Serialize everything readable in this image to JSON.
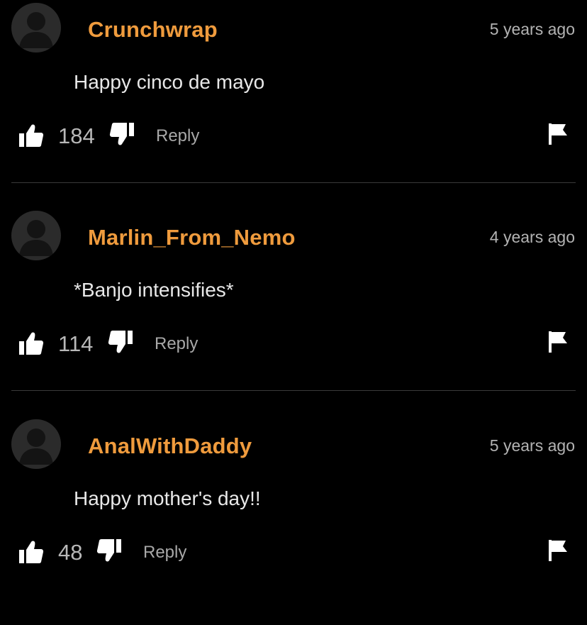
{
  "comments": [
    {
      "username": "Crunchwrap",
      "time": "5 years ago",
      "text": "Happy cinco de mayo",
      "likes": "184",
      "reply_label": "Reply"
    },
    {
      "username": "Marlin_From_Nemo",
      "time": "4 years ago",
      "text": "*Banjo intensifies*",
      "likes": "114",
      "reply_label": "Reply"
    },
    {
      "username": "AnalWithDaddy",
      "time": "5 years ago",
      "text": "Happy mother's day!!",
      "likes": "48",
      "reply_label": "Reply"
    }
  ],
  "icons": {
    "avatar": "default-user-avatar-icon",
    "like": "thumbs-up-icon",
    "dislike": "thumbs-down-icon",
    "flag": "flag-icon"
  },
  "colors": {
    "background": "#000000",
    "username": "#ef9b3d",
    "text": "#e8e8e8",
    "muted": "#b3b3b3",
    "divider": "#3a3a3a"
  }
}
